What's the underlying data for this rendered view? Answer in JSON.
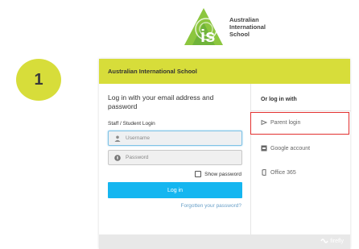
{
  "logo": {
    "line1": "Australian",
    "line2": "International",
    "line3": "School"
  },
  "step": {
    "number": "1"
  },
  "card": {
    "header_title": "Australian International School",
    "heading": "Log in with your email address and password",
    "staff_label": "Staff / Student Login",
    "username_placeholder": "Username",
    "password_placeholder": "Password",
    "show_password_label": "Show password",
    "login_button": "Log in",
    "forgot_link": "Forgotten your password?"
  },
  "providers": {
    "title": "Or log in with",
    "parent_login": "Parent login",
    "google_account": "Google account",
    "office365": "Office 365"
  },
  "footer": {
    "brand": "firefly"
  },
  "colors": {
    "accent": "#d7dd3a",
    "login_button": "#15b6f0",
    "highlight_border": "#e2302f"
  }
}
